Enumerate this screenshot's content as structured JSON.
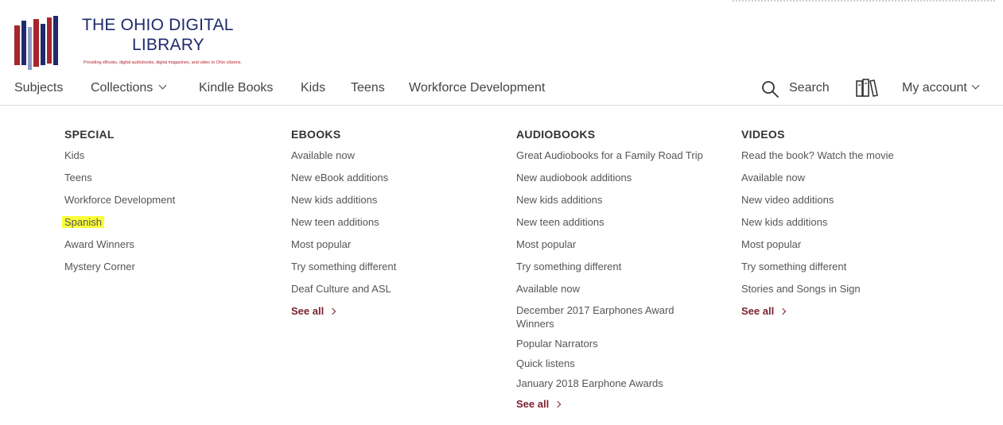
{
  "logo": {
    "title_line1": "THE OHIO DIGITAL",
    "title_line2": "LIBRARY",
    "tagline": "Providing eBooks, digital audiobooks, digital magazines, and video to Ohio citizens."
  },
  "nav": {
    "items": [
      "Subjects",
      "Collections",
      "Kindle Books",
      "Kids",
      "Teens",
      "Workforce Development"
    ],
    "search_label": "Search",
    "account_label": "My account"
  },
  "menu": {
    "special": {
      "heading": "SPECIAL",
      "items": [
        "Kids",
        "Teens",
        "Workforce Development",
        "Spanish",
        "Award Winners",
        "Mystery Corner"
      ]
    },
    "ebooks": {
      "heading": "EBOOKS",
      "items": [
        "Available now",
        "New eBook additions",
        "New kids additions",
        "New teen additions",
        "Most popular",
        "Try something different",
        "Deaf Culture and ASL"
      ],
      "see_all": "See all"
    },
    "audiobooks": {
      "heading": "AUDIOBOOKS",
      "items": [
        "Great Audiobooks for a Family Road Trip",
        "New audiobook additions",
        "New kids additions",
        "New teen additions",
        "Most popular",
        "Try something different",
        "Available now",
        "December 2017 Earphones Award Winners",
        "Popular Narrators",
        "Quick listens",
        "January 2018 Earphone Awards"
      ],
      "see_all": "See all"
    },
    "videos": {
      "heading": "VIDEOS",
      "items": [
        "Read the book? Watch the movie",
        "Available now",
        "New video additions",
        "New kids additions",
        "Most popular",
        "Try something different",
        "Stories and Songs in Sign"
      ],
      "see_all": "See all"
    }
  },
  "colors": {
    "brand_navy": "#1f2a6b",
    "brand_red": "#b3232b",
    "see_all": "#7b2230",
    "highlight": "#fbff3a"
  },
  "icons": {
    "search": "magnifier",
    "bookshelf": "books",
    "collections_caret": "chevron-down",
    "account_caret": "chevron-down",
    "see_all_arrow": "chevron-right"
  }
}
